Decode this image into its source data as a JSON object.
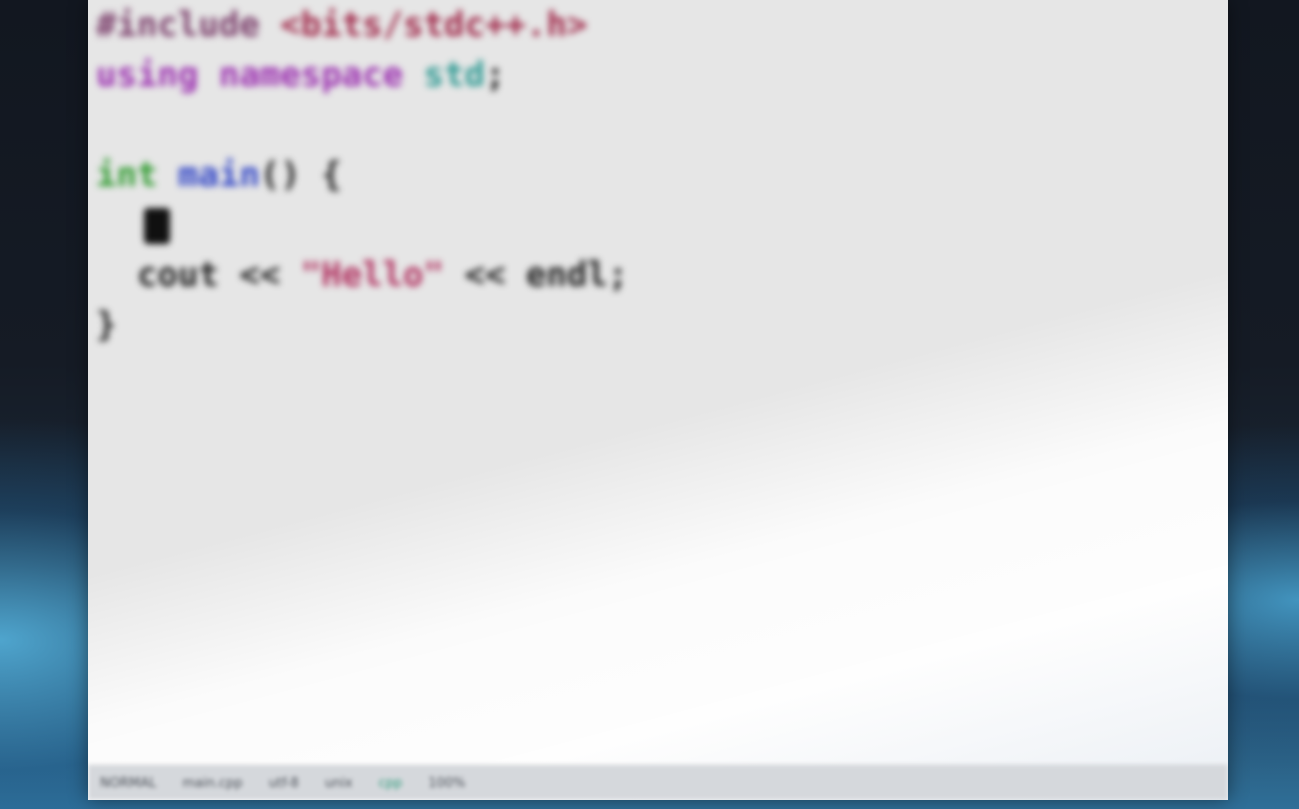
{
  "editor": {
    "lines": [
      {
        "tokens": [
          {
            "text": "#include",
            "kind": "directive"
          },
          {
            "text": " ",
            "kind": "plain"
          },
          {
            "text": "<bits/stdc++.h>",
            "kind": "header"
          }
        ]
      },
      {
        "tokens": [
          {
            "text": "using",
            "kind": "keyword"
          },
          {
            "text": " ",
            "kind": "plain"
          },
          {
            "text": "namespace",
            "kind": "keyword"
          },
          {
            "text": " ",
            "kind": "plain"
          },
          {
            "text": "std",
            "kind": "ns"
          },
          {
            "text": ";",
            "kind": "plain"
          }
        ]
      },
      {
        "tokens": []
      },
      {
        "tokens": [
          {
            "text": "int",
            "kind": "type"
          },
          {
            "text": " ",
            "kind": "plain"
          },
          {
            "text": "main",
            "kind": "func"
          },
          {
            "text": "() {",
            "kind": "plain"
          }
        ]
      },
      {
        "tokens": [],
        "cursor": true
      },
      {
        "tokens": [
          {
            "text": "  cout << ",
            "kind": "plain"
          },
          {
            "text": "\"Hello\"",
            "kind": "string"
          },
          {
            "text": " << endl;",
            "kind": "plain"
          }
        ]
      },
      {
        "tokens": [
          {
            "text": "}",
            "kind": "plain"
          }
        ]
      }
    ]
  },
  "colors": {
    "directive": "#7a3d6a",
    "header": "#a0294a",
    "keyword": "#9b2fb0",
    "ns": "#2f9a93",
    "type": "#2e9a2e",
    "func": "#3246c6",
    "string": "#b0305f",
    "editor_background": "#e6e6e6"
  },
  "statusbar": {
    "items": [
      "NORMAL",
      "main.cpp",
      "utf-8",
      "unix",
      "cpp",
      "100%"
    ]
  }
}
